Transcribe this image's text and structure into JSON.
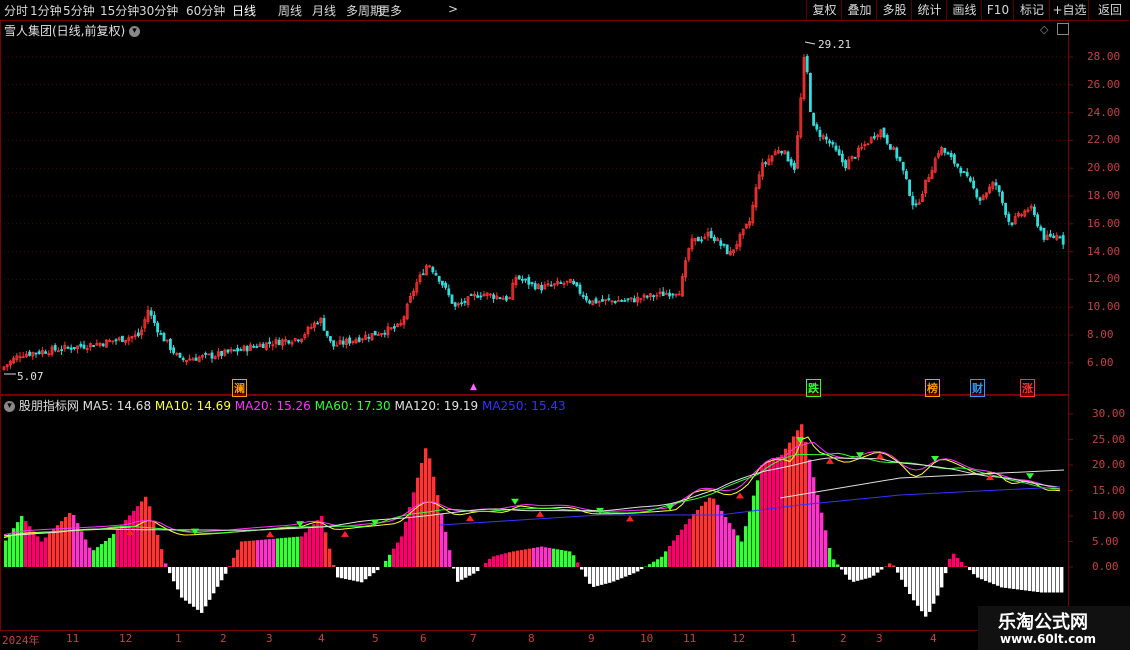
{
  "toolbar": {
    "periods": [
      "分时",
      "1分钟",
      "5分钟",
      "15分钟",
      "30分钟",
      "60分钟",
      "日线",
      "周线",
      "月线",
      "多周期",
      "更多"
    ],
    "active_period": "日线",
    "more_chevron": ">",
    "right_buttons": [
      "复权",
      "叠加",
      "多股",
      "统计",
      "画线",
      "F10",
      "+自选",
      "返回"
    ],
    "right_buttons_alt": "标记"
  },
  "main_panel": {
    "title": "雪人集团(日线,前复权)",
    "high_label": "29.21",
    "low_label": "5.07",
    "y_ticks": [
      "28.00",
      "26.00",
      "24.00",
      "22.00",
      "20.00",
      "18.00",
      "16.00",
      "14.00",
      "12.00",
      "10.00",
      "8.00",
      "6.00"
    ],
    "event_markers": [
      {
        "text": "澜",
        "color": "#ff9900"
      },
      {
        "text": "跌",
        "color": "#33ff33"
      },
      {
        "text": "榜",
        "color": "#ff9900"
      },
      {
        "text": "财",
        "color": "#3399ff"
      },
      {
        "text": "涨",
        "color": "#ff3333"
      }
    ]
  },
  "indicator_panel": {
    "name": "股朋指标网",
    "ma": [
      {
        "label": "MA5: 14.68",
        "color": "#e0e0e0"
      },
      {
        "label": "MA10: 14.69",
        "color": "#ffff33"
      },
      {
        "label": "MA20: 15.26",
        "color": "#ff33ff"
      },
      {
        "label": "MA60: 17.30",
        "color": "#33ff33"
      },
      {
        "label": "MA120: 19.19",
        "color": "#e0e0e0"
      },
      {
        "label": "MA250: 15.43",
        "color": "#3333ff"
      }
    ],
    "y_ticks": [
      "30.00",
      "25.00",
      "20.00",
      "15.00",
      "10.00",
      "5.00",
      "0.00"
    ]
  },
  "x_axis": [
    "2024年",
    "11",
    "12",
    "1",
    "2",
    "3",
    "4",
    "5",
    "6",
    "7",
    "8",
    "9",
    "10",
    "11",
    "12",
    "1",
    "2",
    "3",
    "4"
  ],
  "watermark": {
    "line1": "乐淘公式网",
    "line2": "www.60lt.com"
  },
  "colors": {
    "up": "#ff3333",
    "down": "#33dddd",
    "border": "#7a0000",
    "grid": "#5a0000"
  }
}
